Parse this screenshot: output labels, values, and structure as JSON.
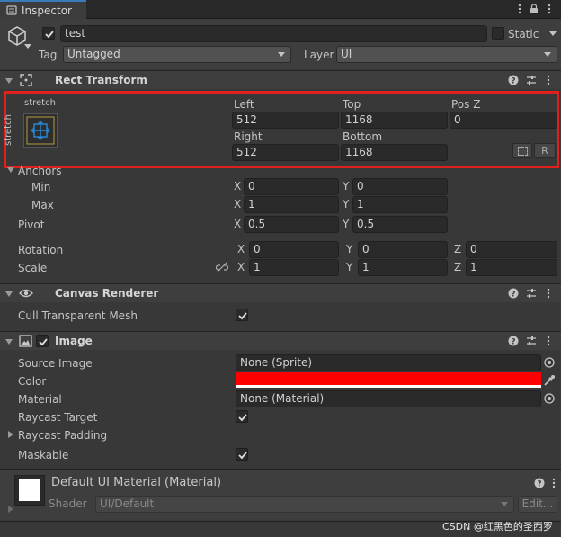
{
  "tab": {
    "title": "Inspector"
  },
  "object": {
    "name": "test",
    "static_label": "Static",
    "tag_label": "Tag",
    "tag_value": "Untagged",
    "layer_label": "Layer",
    "layer_value": "UI"
  },
  "rect_transform": {
    "title": "Rect Transform",
    "anchor_preset_h": "stretch",
    "anchor_preset_v": "stretch",
    "left_label": "Left",
    "left": "512",
    "top_label": "Top",
    "top": "1168",
    "posz_label": "Pos Z",
    "posz": "0",
    "right_label": "Right",
    "right": "512",
    "bottom_label": "Bottom",
    "bottom": "1168",
    "r_button": "R",
    "anchors_label": "Anchors",
    "min_label": "Min",
    "min_x": "0",
    "min_y": "0",
    "max_label": "Max",
    "max_x": "1",
    "max_y": "1",
    "pivot_label": "Pivot",
    "pivot_x": "0.5",
    "pivot_y": "0.5",
    "rotation_label": "Rotation",
    "rot_x": "0",
    "rot_y": "0",
    "rot_z": "0",
    "scale_label": "Scale",
    "scale_x": "1",
    "scale_y": "1",
    "scale_z": "1",
    "x": "X",
    "y": "Y",
    "z": "Z"
  },
  "canvas_renderer": {
    "title": "Canvas Renderer",
    "cull_label": "Cull Transparent Mesh"
  },
  "image": {
    "title": "Image",
    "source_label": "Source Image",
    "source_value": "None (Sprite)",
    "color_label": "Color",
    "color_value": "#ff0000",
    "material_label": "Material",
    "material_value": "None (Material)",
    "raycast_target_label": "Raycast Target",
    "raycast_padding_label": "Raycast Padding",
    "maskable_label": "Maskable"
  },
  "material_preview": {
    "title": "Default UI Material (Material)",
    "shader_label": "Shader",
    "shader_value": "UI/Default",
    "edit_button": "Edit..."
  },
  "watermark": "CSDN @红黑色的圣西罗",
  "colors": {
    "highlight": "#e0201c",
    "accent_blue": "#2b8ad6"
  }
}
